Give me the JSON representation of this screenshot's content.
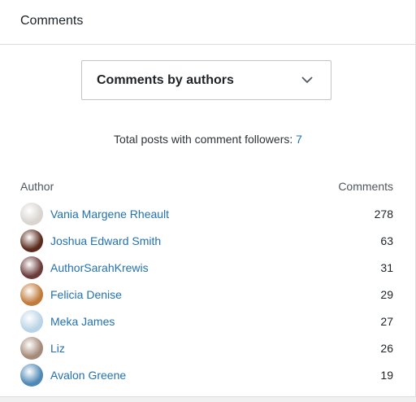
{
  "panel": {
    "title": "Comments"
  },
  "filter": {
    "selected": "Comments by authors",
    "chevron_icon": "chevron-down-icon"
  },
  "summary": {
    "text": "Total posts with comment followers: ",
    "value": "7"
  },
  "table": {
    "headers": {
      "author": "Author",
      "comments": "Comments"
    },
    "rows": [
      {
        "author": "Vania Margene Rheault",
        "comments": "278",
        "avatar": "avatar-photo",
        "avatar_color": "#d8d4cf"
      },
      {
        "author": "Joshua Edward Smith",
        "comments": "63",
        "avatar": "avatar-photo",
        "avatar_color": "#5a2a1c"
      },
      {
        "author": "AuthorSarahKrewis",
        "comments": "31",
        "avatar": "avatar-photo",
        "avatar_color": "#6b3a3a"
      },
      {
        "author": "Felicia Denise",
        "comments": "29",
        "avatar": "avatar-photo",
        "avatar_color": "#c07a3a"
      },
      {
        "author": "Meka James",
        "comments": "27",
        "avatar": "avatar-photo",
        "avatar_color": "#b9d4e6"
      },
      {
        "author": "Liz",
        "comments": "26",
        "avatar": "avatar-photo",
        "avatar_color": "#a48a78"
      },
      {
        "author": "Avalon Greene",
        "comments": "19",
        "avatar": "avatar-photo",
        "avatar_color": "#4f88b4"
      }
    ]
  }
}
